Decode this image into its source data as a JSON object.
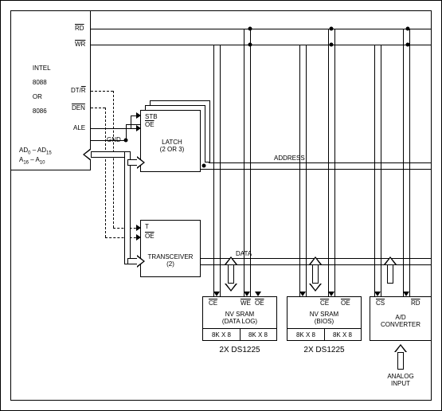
{
  "cpu": {
    "line1": "INTEL",
    "line2": "8088",
    "line3": "OR",
    "line4": "8086",
    "pin_rd": "RD",
    "pin_wr": "WR",
    "pin_dtr": "DT/R",
    "pin_den": "DEN",
    "pin_ale": "ALE",
    "pin_gnd": "GND",
    "pin_ad": "AD0 – AD15",
    "pin_a": "A16 – A10"
  },
  "latch": {
    "title1": "LATCH",
    "title2": "(2 OR 3)",
    "pin_stb": "STB",
    "pin_oe": "OE"
  },
  "xcvr": {
    "title1": "TRANSCEIVER",
    "title2": "(2)",
    "pin_t": "T",
    "pin_oe": "OE"
  },
  "buses": {
    "address": "ADDRESS",
    "data": "DATA"
  },
  "nvsram1": {
    "title1": "NV SRAM",
    "title2": "(DATA LOG)",
    "chip_label": "8K X 8",
    "bottom": "2X DS1225",
    "pin_ce": "CE",
    "pin_we": "WE",
    "pin_oe": "OE"
  },
  "nvsram2": {
    "title1": "NV SRAM",
    "title2": "(BIOS)",
    "chip_label": "8K X 8",
    "bottom": "2X DS1225",
    "pin_ce": "CE",
    "pin_oe": "OE"
  },
  "adc": {
    "title1": "A/D",
    "title2": "CONVERTER",
    "pin_cs": "CS",
    "pin_rd": "RD",
    "input1": "ANALOG",
    "input2": "INPUT"
  }
}
